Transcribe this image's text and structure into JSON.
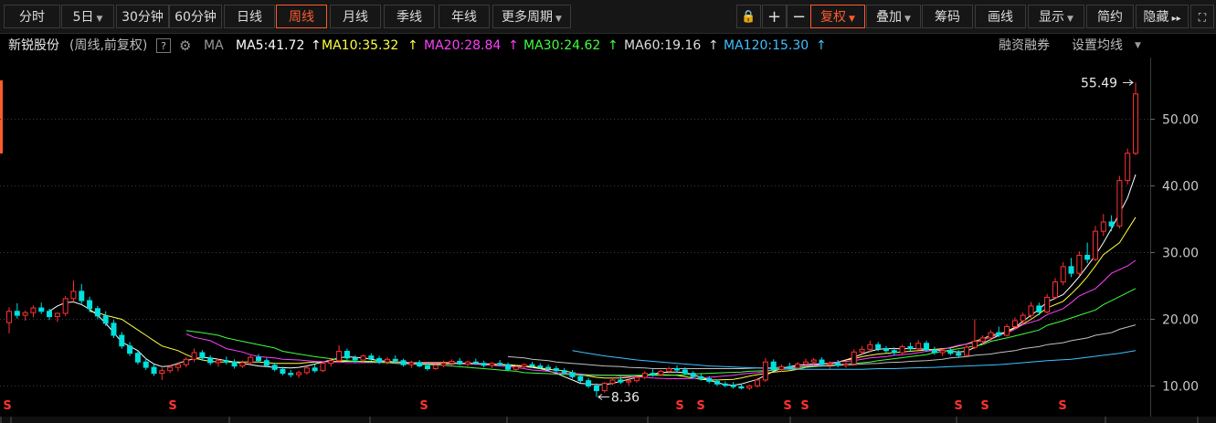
{
  "toolbar": {
    "periods": [
      "分时",
      "5日",
      "30分钟",
      "60分钟",
      "日线",
      "周线",
      "月线",
      "季线",
      "年线",
      "更多周期"
    ],
    "active_period": "周线",
    "right_buttons": [
      "复权",
      "叠加",
      "筹码",
      "画线",
      "显示",
      "简约",
      "隐藏"
    ],
    "icons": [
      "lock-icon",
      "zoom-in-icon",
      "zoom-out-icon",
      "expand-icon",
      "fullscreen-icon"
    ]
  },
  "info": {
    "stock_name": "新锐股份",
    "mode": "(周线,前复权)",
    "help": "?",
    "ma_label": "MA",
    "ma5": "MA5:41.72",
    "ma10": "MA10:35.32",
    "ma20": "MA20:28.84",
    "ma30": "MA30:24.62",
    "ma60": "MA60:19.16",
    "ma120": "MA120:15.30",
    "link1": "融资融券",
    "link2": "设置均线"
  },
  "colors": {
    "up": "#ff3232",
    "down": "#00e0e0",
    "ma5": "#ffffff",
    "ma10": "#ffff40",
    "ma20": "#ff40ff",
    "ma30": "#40ff40",
    "ma60": "#c0c0c0",
    "ma120": "#40c0ff",
    "accent": "#ff5a2d"
  },
  "chart_data": {
    "type": "candlestick",
    "y_ticks": [
      "50.00",
      "40.00",
      "30.00",
      "20.00",
      "10.00"
    ],
    "ylim": [
      8,
      56
    ],
    "max_label": "55.49",
    "min_label": "8.36",
    "markers": [
      "S",
      "S",
      "S",
      "S",
      "S",
      "S",
      "S",
      "S",
      "S",
      "S"
    ],
    "ohlc": [
      [
        19.5,
        21.8,
        17.9,
        21.2
      ],
      [
        21.2,
        22.4,
        20.1,
        20.6
      ],
      [
        20.6,
        21.3,
        19.8,
        21.0
      ],
      [
        21.0,
        22.1,
        20.3,
        21.7
      ],
      [
        21.7,
        22.5,
        20.8,
        21.2
      ],
      [
        21.2,
        21.6,
        19.9,
        20.4
      ],
      [
        20.4,
        21.0,
        19.6,
        20.9
      ],
      [
        20.9,
        23.5,
        20.5,
        23.1
      ],
      [
        23.1,
        25.8,
        22.6,
        24.2
      ],
      [
        24.2,
        25.3,
        22.3,
        22.8
      ],
      [
        22.8,
        23.4,
        21.1,
        21.6
      ],
      [
        21.6,
        22.0,
        20.0,
        20.5
      ],
      [
        20.5,
        21.2,
        19.0,
        19.4
      ],
      [
        19.4,
        19.9,
        17.2,
        17.6
      ],
      [
        17.6,
        18.1,
        15.6,
        16.0
      ],
      [
        16.0,
        16.6,
        14.5,
        14.9
      ],
      [
        14.9,
        15.3,
        13.2,
        13.6
      ],
      [
        13.6,
        14.2,
        12.4,
        12.8
      ],
      [
        12.8,
        13.3,
        11.5,
        11.9
      ],
      [
        11.9,
        12.7,
        10.9,
        12.3
      ],
      [
        12.3,
        13.2,
        11.9,
        12.8
      ],
      [
        12.8,
        13.6,
        12.2,
        13.2
      ],
      [
        13.2,
        14.3,
        12.8,
        14.0
      ],
      [
        14.0,
        15.6,
        13.6,
        15.0
      ],
      [
        15.0,
        15.4,
        13.8,
        14.2
      ],
      [
        14.2,
        14.6,
        13.1,
        13.5
      ],
      [
        13.5,
        14.1,
        12.9,
        13.8
      ],
      [
        13.8,
        14.4,
        13.2,
        13.6
      ],
      [
        13.6,
        14.0,
        12.6,
        13.0
      ],
      [
        13.0,
        13.8,
        12.7,
        13.5
      ],
      [
        13.5,
        14.6,
        13.2,
        14.3
      ],
      [
        14.3,
        14.8,
        13.5,
        13.8
      ],
      [
        13.8,
        14.2,
        12.8,
        13.1
      ],
      [
        13.1,
        13.5,
        12.2,
        12.5
      ],
      [
        12.5,
        12.9,
        11.6,
        11.9
      ],
      [
        11.9,
        12.4,
        11.3,
        11.7
      ],
      [
        11.7,
        12.3,
        11.2,
        12.0
      ],
      [
        12.0,
        12.9,
        11.7,
        12.7
      ],
      [
        12.7,
        13.3,
        12.0,
        12.3
      ],
      [
        12.3,
        13.6,
        12.1,
        13.4
      ],
      [
        13.4,
        14.2,
        12.9,
        13.8
      ],
      [
        13.8,
        16.1,
        13.5,
        15.2
      ],
      [
        15.2,
        15.6,
        13.9,
        14.2
      ],
      [
        14.2,
        14.6,
        13.4,
        13.9
      ],
      [
        13.9,
        14.7,
        13.6,
        14.5
      ],
      [
        14.5,
        14.9,
        13.8,
        14.1
      ],
      [
        14.1,
        14.5,
        13.3,
        13.6
      ],
      [
        13.6,
        14.3,
        13.2,
        14.0
      ],
      [
        14.0,
        14.6,
        13.5,
        13.8
      ],
      [
        13.8,
        14.1,
        12.9,
        13.2
      ],
      [
        13.2,
        13.8,
        12.7,
        13.5
      ],
      [
        13.5,
        13.9,
        12.8,
        13.0
      ],
      [
        13.0,
        13.4,
        12.3,
        12.6
      ],
      [
        12.6,
        13.3,
        12.4,
        13.1
      ],
      [
        13.1,
        13.8,
        12.8,
        13.4
      ],
      [
        13.4,
        14.0,
        13.0,
        13.7
      ],
      [
        13.7,
        14.2,
        13.1,
        13.3
      ],
      [
        13.3,
        13.8,
        12.9,
        13.6
      ],
      [
        13.6,
        14.1,
        13.2,
        13.4
      ],
      [
        13.4,
        13.8,
        12.8,
        13.1
      ],
      [
        13.1,
        13.6,
        12.7,
        13.4
      ],
      [
        13.4,
        13.9,
        13.0,
        13.2
      ],
      [
        13.2,
        13.5,
        12.2,
        12.5
      ],
      [
        12.5,
        13.1,
        12.2,
        12.9
      ],
      [
        12.9,
        13.4,
        12.6,
        13.2
      ],
      [
        13.2,
        13.6,
        12.8,
        13.0
      ],
      [
        13.0,
        13.4,
        12.5,
        12.8
      ],
      [
        12.8,
        13.2,
        12.3,
        12.6
      ],
      [
        12.6,
        13.0,
        12.1,
        12.3
      ],
      [
        12.3,
        12.7,
        11.8,
        12.0
      ],
      [
        12.0,
        12.4,
        11.1,
        11.4
      ],
      [
        11.4,
        11.8,
        10.5,
        10.8
      ],
      [
        10.8,
        11.2,
        9.7,
        10.0
      ],
      [
        10.0,
        10.4,
        8.36,
        9.3
      ],
      [
        9.3,
        10.6,
        9.0,
        10.4
      ],
      [
        10.4,
        11.2,
        10.1,
        10.9
      ],
      [
        10.9,
        11.4,
        10.3,
        10.6
      ],
      [
        10.6,
        11.0,
        10.0,
        10.8
      ],
      [
        10.8,
        11.5,
        10.5,
        11.3
      ],
      [
        11.3,
        12.2,
        11.0,
        11.9
      ],
      [
        11.9,
        12.5,
        11.4,
        11.7
      ],
      [
        11.7,
        12.4,
        11.5,
        12.2
      ],
      [
        12.2,
        12.9,
        11.9,
        12.6
      ],
      [
        12.6,
        13.1,
        12.1,
        12.4
      ],
      [
        12.4,
        12.8,
        11.6,
        11.9
      ],
      [
        11.9,
        12.2,
        11.1,
        11.4
      ],
      [
        11.4,
        11.8,
        10.8,
        11.1
      ],
      [
        11.1,
        11.5,
        10.4,
        10.7
      ],
      [
        10.7,
        11.0,
        10.0,
        10.3
      ],
      [
        10.3,
        10.7,
        9.8,
        10.1
      ],
      [
        10.1,
        10.6,
        9.6,
        9.9
      ],
      [
        9.9,
        10.3,
        9.5,
        9.7
      ],
      [
        9.7,
        10.2,
        9.4,
        10.0
      ],
      [
        10.0,
        11.2,
        9.8,
        10.9
      ],
      [
        10.9,
        14.2,
        10.6,
        13.6
      ],
      [
        13.6,
        14.0,
        12.2,
        12.5
      ],
      [
        12.5,
        13.2,
        12.1,
        12.9
      ],
      [
        12.9,
        13.5,
        12.4,
        12.7
      ],
      [
        12.7,
        13.6,
        12.5,
        13.3
      ],
      [
        13.3,
        14.1,
        12.9,
        13.6
      ],
      [
        13.6,
        14.2,
        13.1,
        13.9
      ],
      [
        13.9,
        14.3,
        12.9,
        13.2
      ],
      [
        13.2,
        13.7,
        12.6,
        13.4
      ],
      [
        13.4,
        13.9,
        12.8,
        13.1
      ],
      [
        13.1,
        13.6,
        12.7,
        13.3
      ],
      [
        13.3,
        15.5,
        13.1,
        15.1
      ],
      [
        15.1,
        16.0,
        14.6,
        15.5
      ],
      [
        15.5,
        16.8,
        15.0,
        16.2
      ],
      [
        16.2,
        16.6,
        15.2,
        15.6
      ],
      [
        15.6,
        16.0,
        14.9,
        15.3
      ],
      [
        15.3,
        15.8,
        14.6,
        15.0
      ],
      [
        15.0,
        16.2,
        14.8,
        15.9
      ],
      [
        15.9,
        16.5,
        15.2,
        15.6
      ],
      [
        15.6,
        16.9,
        15.4,
        16.4
      ],
      [
        16.4,
        16.8,
        15.1,
        15.4
      ],
      [
        15.4,
        15.9,
        14.7,
        15.0
      ],
      [
        15.0,
        15.6,
        14.5,
        15.3
      ],
      [
        15.3,
        15.8,
        14.6,
        14.9
      ],
      [
        14.9,
        15.4,
        14.2,
        14.6
      ],
      [
        14.6,
        16.2,
        14.4,
        15.8
      ],
      [
        15.8,
        20.0,
        15.5,
        16.7
      ],
      [
        16.7,
        17.6,
        16.2,
        17.2
      ],
      [
        17.2,
        18.4,
        16.8,
        18.0
      ],
      [
        18.0,
        18.9,
        17.3,
        17.6
      ],
      [
        17.6,
        19.3,
        17.4,
        18.9
      ],
      [
        18.9,
        20.3,
        18.5,
        19.8
      ],
      [
        19.8,
        21.0,
        19.2,
        20.6
      ],
      [
        20.6,
        22.6,
        20.2,
        22.0
      ],
      [
        22.0,
        22.5,
        20.6,
        21.1
      ],
      [
        21.1,
        23.8,
        20.9,
        23.3
      ],
      [
        23.3,
        26.2,
        23.0,
        25.6
      ],
      [
        25.6,
        28.6,
        25.1,
        27.9
      ],
      [
        27.9,
        29.2,
        26.3,
        26.9
      ],
      [
        26.9,
        30.2,
        26.5,
        29.6
      ],
      [
        29.6,
        31.5,
        28.4,
        29.0
      ],
      [
        29.0,
        34.0,
        28.7,
        33.2
      ],
      [
        33.2,
        35.8,
        32.5,
        34.6
      ],
      [
        34.6,
        35.6,
        33.2,
        34.0
      ],
      [
        34.0,
        41.5,
        33.6,
        40.8
      ],
      [
        40.8,
        45.6,
        40.2,
        44.9
      ],
      [
        44.9,
        55.49,
        44.6,
        53.8
      ]
    ],
    "ma_series": [
      {
        "name": "MA5",
        "start": 5,
        "values": [
          21.2,
          22.0,
          22.5,
          22.6,
          22.2,
          21.5,
          20.6,
          19.4,
          18.0,
          16.6,
          15.3,
          14.1,
          13.3,
          12.9,
          13.0,
          13.4,
          13.8,
          14.1,
          14.3,
          14.2,
          14.0,
          13.8,
          13.6,
          13.4,
          13.2,
          13.0,
          12.9,
          12.8,
          12.7,
          12.8,
          13.0,
          13.3,
          13.6,
          13.9,
          14.2,
          14.4,
          14.3,
          14.2,
          14.0,
          13.8,
          13.7,
          13.6,
          13.5,
          13.4,
          13.3,
          13.3,
          13.3,
          13.3,
          13.4,
          13.4,
          13.4,
          13.3,
          13.3,
          13.2,
          13.1,
          13.0,
          12.9,
          12.8,
          12.6,
          12.3,
          11.9,
          11.4,
          10.9,
          10.4,
          10.2,
          10.2,
          10.4,
          10.7,
          11.0,
          11.3,
          11.6,
          11.8,
          12.0,
          12.1,
          12.1,
          12.0,
          11.7,
          11.3,
          10.9,
          10.5,
          10.2,
          10.1,
          10.3,
          11.0,
          11.6,
          12.2,
          12.6,
          12.9,
          13.1,
          13.2,
          13.3,
          13.3,
          13.3,
          13.5,
          13.9,
          14.3,
          14.8,
          15.2,
          15.5,
          15.6,
          15.6,
          15.6,
          15.6,
          15.5,
          15.4,
          15.3,
          15.2,
          15.1,
          15.2,
          15.8,
          16.4,
          17.0,
          17.6,
          18.2,
          18.8,
          19.7,
          20.6,
          21.5,
          22.6,
          23.7,
          25.0,
          26.4,
          28.0,
          29.6,
          31.5,
          33.6,
          35.9,
          38.2,
          41.7
        ]
      },
      {
        "name": "MA10",
        "start": 10,
        "values": [
          21.2,
          21.0,
          20.6,
          20.0,
          19.2,
          18.4,
          17.6,
          16.8,
          16.0,
          15.3,
          14.7,
          14.2,
          13.9,
          13.7,
          13.6,
          13.6,
          13.6,
          13.6,
          13.6,
          13.5,
          13.4,
          13.4,
          13.4,
          13.5,
          13.6,
          13.6,
          13.7,
          13.7,
          13.7,
          13.7,
          13.7,
          13.6,
          13.6,
          13.6,
          13.5,
          13.5,
          13.5,
          13.5,
          13.5,
          13.4,
          13.4,
          13.3,
          13.3,
          13.2,
          13.2,
          13.1,
          13.0,
          12.9,
          12.7,
          12.5,
          12.3,
          12.0,
          11.7,
          11.5,
          11.3,
          11.2,
          11.2,
          11.3,
          11.5,
          11.6,
          11.7,
          11.7,
          11.6,
          11.4,
          11.2,
          11.0,
          10.9,
          10.9,
          11.0,
          11.2,
          11.5,
          11.7,
          11.9,
          12.1,
          12.3,
          12.5,
          12.8,
          13.0,
          13.3,
          13.6,
          13.9,
          14.1,
          14.4,
          14.6,
          14.8,
          15.0,
          15.1,
          15.2,
          15.3,
          15.4,
          15.5,
          15.7,
          16.0,
          16.3,
          16.7,
          17.1,
          17.6,
          18.1,
          18.7,
          19.3,
          20.0,
          20.8,
          21.7,
          22.7,
          23.8,
          25.0,
          26.4,
          28.0,
          29.7,
          31.5,
          33.4,
          35.3
        ]
      },
      {
        "name": "MA20",
        "start": 22,
        "values": [
          17.8,
          17.3,
          16.8,
          16.2,
          15.6,
          15.1,
          14.7,
          14.4,
          14.2,
          14.0,
          13.9,
          13.8,
          13.7,
          13.6,
          13.6,
          13.5,
          13.5,
          13.5,
          13.5,
          13.5,
          13.5,
          13.5,
          13.4,
          13.4,
          13.4,
          13.3,
          13.3,
          13.2,
          13.1,
          13.0,
          12.8,
          12.6,
          12.4,
          12.2,
          12.0,
          11.9,
          11.8,
          11.7,
          11.6,
          11.6,
          11.5,
          11.4,
          11.3,
          11.2,
          11.1,
          11.1,
          11.1,
          11.2,
          11.3,
          11.4,
          11.6,
          11.8,
          12.0,
          12.2,
          12.4,
          12.6,
          12.8,
          13.0,
          13.2,
          13.4,
          13.6,
          13.8,
          14.0,
          14.2,
          14.4,
          14.6,
          14.8,
          15.0,
          15.2,
          15.5,
          15.8,
          16.1,
          16.5,
          16.9,
          17.4,
          17.9,
          18.5,
          19.2,
          19.9,
          20.7,
          21.6,
          22.5,
          23.5,
          24.6,
          25.7,
          26.9,
          28.0,
          28.84
        ]
      },
      {
        "name": "MA30",
        "start": 22,
        "values": [
          18.3,
          18.0,
          17.6,
          17.2,
          16.7,
          16.2,
          15.7,
          15.2,
          14.8,
          14.4,
          14.1,
          13.9,
          13.7,
          13.6,
          13.5,
          13.4,
          13.3,
          13.2,
          13.1,
          13.0,
          12.8,
          12.6,
          12.4,
          12.2,
          12.0,
          11.9,
          11.8,
          11.7,
          11.6,
          11.6,
          11.6,
          11.6,
          11.6,
          11.6,
          11.6,
          11.7,
          11.8,
          11.9,
          12.0,
          12.1,
          12.2,
          12.3,
          12.5,
          12.6,
          12.8,
          13.0,
          13.2,
          13.4,
          13.6,
          13.8,
          14.1,
          14.4,
          14.7,
          15.0,
          15.4,
          15.8,
          16.2,
          16.7,
          17.2,
          17.8,
          18.4,
          19.1,
          19.8,
          20.6,
          21.4,
          22.2,
          23.4,
          24.62
        ]
      },
      {
        "name": "MA60",
        "start": 62,
        "values": [
          14.4,
          14.2,
          14.0,
          13.8,
          13.6,
          13.4,
          13.3,
          13.1,
          13.0,
          12.9,
          12.8,
          12.7,
          12.6,
          12.6,
          12.6,
          12.6,
          12.6,
          12.6,
          12.6,
          12.6,
          12.7,
          12.7,
          12.8,
          12.8,
          12.9,
          13.0,
          13.0,
          13.1,
          13.2,
          13.3,
          13.4,
          13.5,
          13.6,
          13.7,
          13.8,
          14.0,
          14.2,
          14.4,
          14.6,
          14.8,
          15.0,
          15.3,
          15.6,
          15.9,
          16.2,
          16.5,
          16.8,
          17.2,
          17.6,
          18.0,
          18.5,
          19.16
        ]
      },
      {
        "name": "MA120",
        "start": 70,
        "values": [
          15.3,
          14.9,
          14.5,
          14.2,
          13.9,
          13.6,
          13.4,
          13.2,
          13.0,
          12.9,
          12.8,
          12.7,
          12.6,
          12.5,
          12.5,
          12.5,
          12.5,
          12.5,
          12.6,
          12.6,
          12.7,
          12.8,
          12.9,
          13.0,
          13.1,
          13.2,
          13.4,
          13.6,
          13.8,
          14.0,
          14.3,
          14.6,
          14.9,
          15.3
        ]
      }
    ]
  }
}
